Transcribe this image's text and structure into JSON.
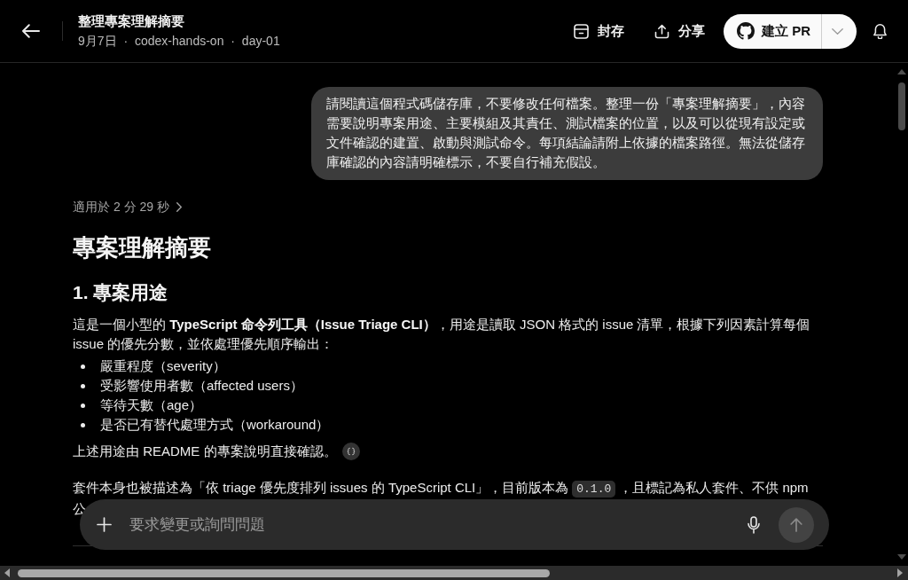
{
  "header": {
    "title": "整理專案理解摘要",
    "subtitle": "9月7日 · codex-hands-on · day-01",
    "actions": [
      {
        "kind": "archive",
        "label": "封存"
      },
      {
        "kind": "share",
        "label": "分享"
      }
    ],
    "primary_button": {
      "label": "建立 PR"
    }
  },
  "user_message": {
    "lines": [
      "請閱讀這個程式碼儲存庫，不要修改任何檔案。整理一份「專案理解摘要」，內容",
      "需要說明專案用途、主要模組及其責任、測試檔案的位置，以及可以從現有設定或",
      "文件確認的建置、啟動與測試命令。每項結論請附上依據的檔案路徑。無法從儲存",
      "庫確認的內容請明確標示，不要自行補充假設。"
    ]
  },
  "response": {
    "elapsed": {
      "text": "適用於 2 分 29 秒",
      "expanded": false
    },
    "blocks": [
      {
        "kind": "h1",
        "text": "專案理解摘要"
      },
      {
        "kind": "h2",
        "text": "1. 專案用途"
      },
      {
        "kind": "paragraph",
        "segments": [
          {
            "kind": "text",
            "text": "這是一個小型的 **TypeScript 命令列工具（Issue Triage CLI）**，用途是讀取 JSON 格式的 issue 清單，根據下列因素計算每個"
          },
          {
            "kind": "break"
          },
          {
            "kind": "text",
            "text": "issue 的優先分數，並依處理優先順序輸出："
          }
        ]
      },
      {
        "kind": "bullets",
        "items": [
          "嚴重程度（severity）",
          "受影響使用者數（affected users）",
          "等待天數（age）",
          "是否已有替代處理方式（workaround）"
        ]
      },
      {
        "kind": "paragraph",
        "segments": [
          {
            "kind": "text",
            "text": "上述用途由 README 的專案說明直接確認。"
          },
          {
            "kind": "citation"
          }
        ]
      },
      {
        "kind": "paragraph",
        "segments": [
          {
            "kind": "text",
            "text": "套件本身也被描述為「依 triage 優先度排列 issues 的 TypeScript CLI」，目前版本為"
          },
          {
            "kind": "code",
            "text": "0.1.0"
          },
          {
            "kind": "text",
            "text": "，且標記為私人套件、不供 npm"
          },
          {
            "kind": "break"
          },
          {
            "kind": "text",
            "text": "公"
          }
        ]
      }
    ]
  },
  "composer": {
    "placeholder": "要求變更或詢問問題",
    "send_disabled": true
  }
}
